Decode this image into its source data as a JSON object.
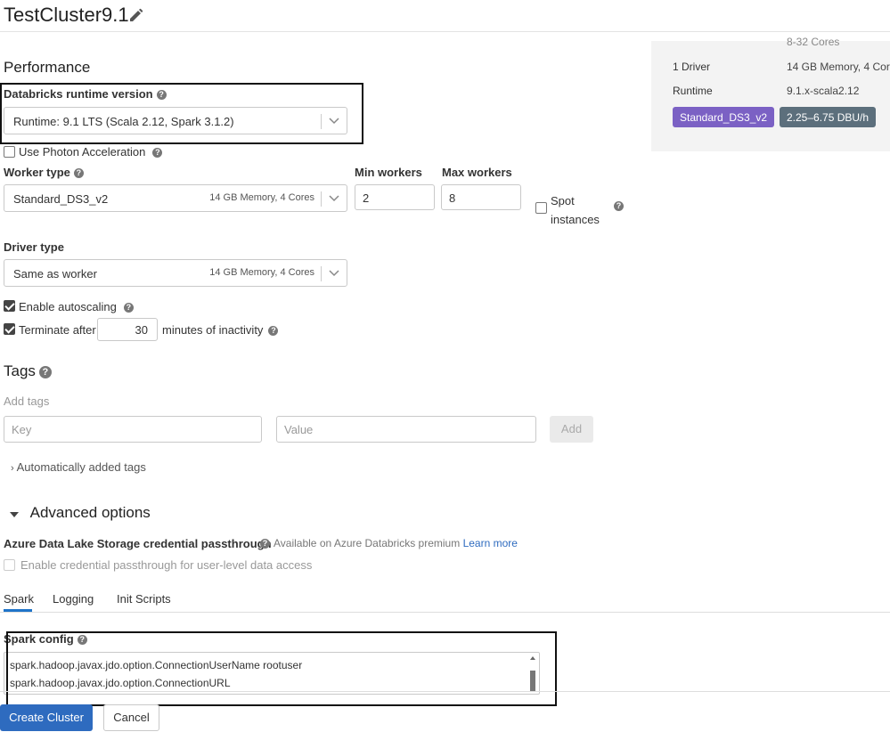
{
  "header": {
    "title": "TestCluster9.1"
  },
  "summary": {
    "cores_partial": "8-32 Cores",
    "driver_label": "1 Driver",
    "driver_value": "14 GB Memory, 4 Cores",
    "runtime_label": "Runtime",
    "runtime_value": "9.1.x-scala2.12",
    "node_badge": "Standard_DS3_v2",
    "dbu_badge": "2.25–6.75 DBU/h",
    "colors": {
      "node_badge": "#7b61c4",
      "dbu_badge": "#5c6f7c"
    }
  },
  "performance": {
    "heading": "Performance",
    "runtime_label": "Databricks runtime version",
    "runtime_value": "Runtime: 9.1 LTS (Scala 2.12, Spark 3.1.2)",
    "photon_label": "Use Photon Acceleration",
    "worker_label": "Worker type",
    "worker_value": "Standard_DS3_v2",
    "worker_meta": "14 GB Memory, 4 Cores",
    "min_label": "Min workers",
    "min_value": "2",
    "max_label": "Max workers",
    "max_value": "8",
    "spot_line1": "Spot",
    "spot_line2": "instances",
    "driver_label": "Driver type",
    "driver_value": "Same as worker",
    "driver_meta": "14 GB Memory, 4 Cores",
    "autoscale_label": "Enable autoscaling",
    "terminate_prefix": "Terminate after",
    "terminate_value": "30",
    "terminate_suffix": "minutes of inactivity"
  },
  "tags": {
    "heading": "Tags",
    "add_tags": "Add tags",
    "key_placeholder": "Key",
    "value_placeholder": "Value",
    "add_button": "Add",
    "auto_added": "Automatically added tags"
  },
  "advanced": {
    "heading": "Advanced options",
    "adls_label": "Azure Data Lake Storage credential passthrough",
    "adls_note": "Available on Azure Databricks premium",
    "learn_more": "Learn more",
    "passthrough_label": "Enable credential passthrough for user-level data access",
    "tabs": [
      "Spark",
      "Logging",
      "Init Scripts"
    ],
    "spark_config_label": "Spark config",
    "spark_config_lines": [
      "spark.hadoop.javax.jdo.option.ConnectionUserName rootuser",
      "spark.hadoop.javax.jdo.option.ConnectionURL"
    ]
  },
  "footer": {
    "create": "Create Cluster",
    "cancel": "Cancel"
  }
}
